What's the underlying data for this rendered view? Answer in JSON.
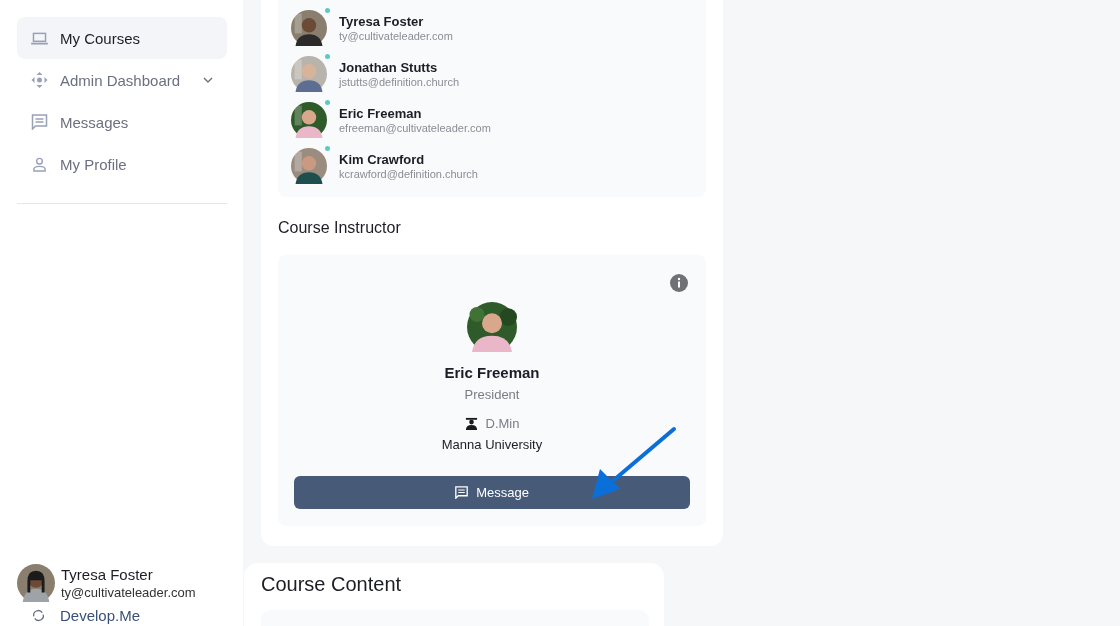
{
  "sidebar": {
    "items": [
      {
        "label": "My Courses",
        "selected": true,
        "expandable": false
      },
      {
        "label": "Admin Dashboard",
        "selected": false,
        "expandable": true
      },
      {
        "label": "Messages",
        "selected": false,
        "expandable": false
      },
      {
        "label": "My Profile",
        "selected": false,
        "expandable": false
      }
    ],
    "user": {
      "name": "Tyresa Foster",
      "email": "ty@cultivateleader.com"
    },
    "app_link": "Develop.Me"
  },
  "participants": [
    {
      "name": "Tyresa Foster",
      "email": "ty@cultivateleader.com",
      "online": true
    },
    {
      "name": "Jonathan Stutts",
      "email": "jstutts@definition.church",
      "online": true
    },
    {
      "name": "Eric Freeman",
      "email": "efreeman@cultivateleader.com",
      "online": true
    },
    {
      "name": "Kim Crawford",
      "email": "kcrawford@definition.church",
      "online": true
    }
  ],
  "instructor": {
    "heading": "Course Instructor",
    "name": "Eric Freeman",
    "title": "President",
    "degree": "D.Min",
    "school": "Manna University",
    "button": "Message"
  },
  "course_content": {
    "heading": "Course Content"
  }
}
